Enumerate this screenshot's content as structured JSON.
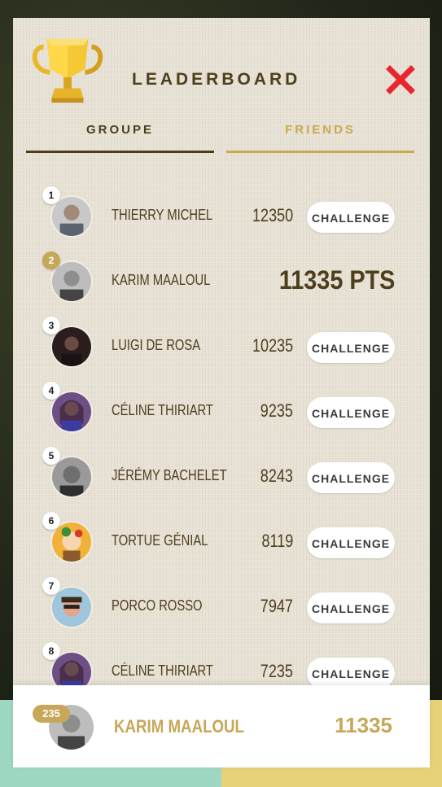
{
  "header": {
    "title": "LEADERBOARD",
    "trophy_icon": "trophy-icon",
    "close_icon": "close-icon"
  },
  "tabs": [
    {
      "label": "GROUPE",
      "active": true
    },
    {
      "label": "FRIENDS",
      "active": false
    }
  ],
  "challenge_label": "CHALLENGE",
  "entries": [
    {
      "rank": "1",
      "name": "THIERRY MICHEL",
      "score": "12350",
      "is_current_user": false
    },
    {
      "rank": "2",
      "name": "KARIM MAALOUL",
      "score": "11335 PTS",
      "is_current_user": true
    },
    {
      "rank": "3",
      "name": "LUIGI DE ROSA",
      "score": "10235",
      "is_current_user": false
    },
    {
      "rank": "4",
      "name": "CÉLINE THIRIART",
      "score": "9235",
      "is_current_user": false
    },
    {
      "rank": "5",
      "name": "JÉRÉMY BACHELET",
      "score": "8243",
      "is_current_user": false
    },
    {
      "rank": "6",
      "name": "TORTUE GÉNIAL",
      "score": "8119",
      "is_current_user": false
    },
    {
      "rank": "7",
      "name": "PORCO ROSSO",
      "score": "7947",
      "is_current_user": false
    },
    {
      "rank": "8",
      "name": "CÉLINE THIRIART",
      "score": "7235",
      "is_current_user": false
    }
  ],
  "footer": {
    "rank": "235",
    "name": "KARIM MAALOUL",
    "score": "11335"
  },
  "colors": {
    "brown": "#4d3e1c",
    "gold": "#c7a758",
    "close_red": "#e8262f",
    "panel": "#e7e1d4"
  }
}
